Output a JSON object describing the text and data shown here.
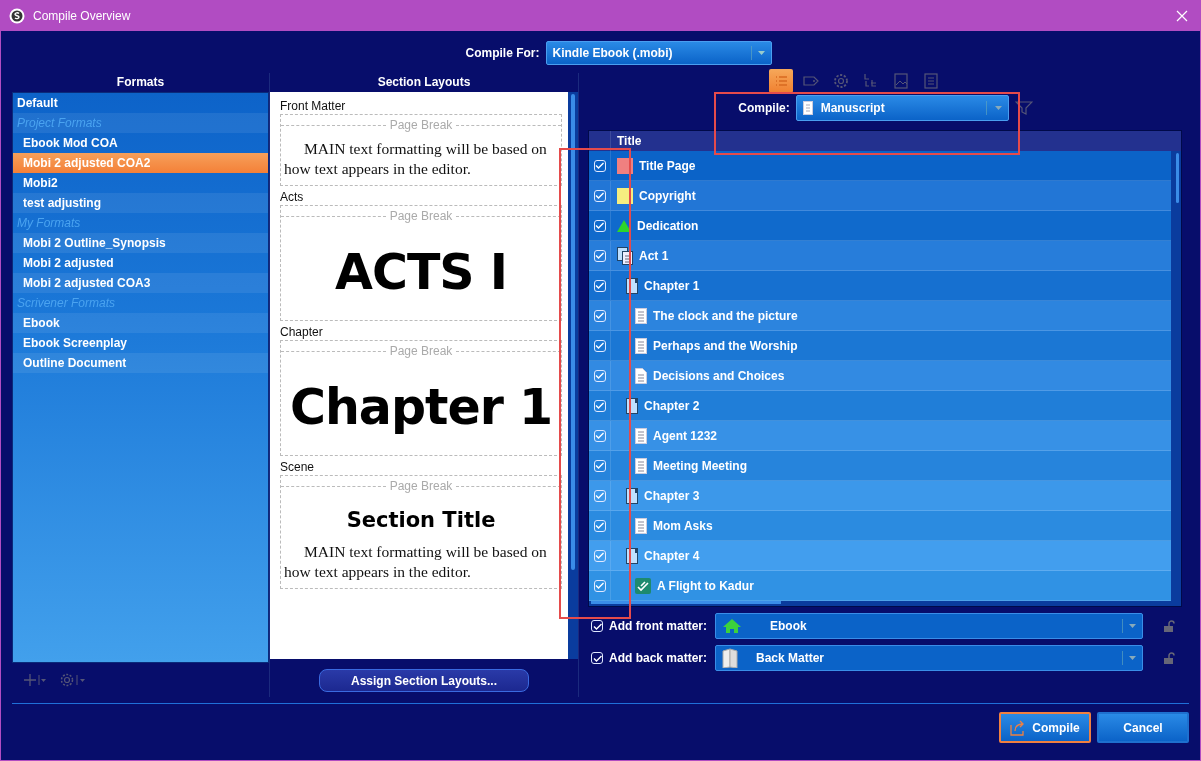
{
  "window": {
    "title": "Compile Overview"
  },
  "compile_for": {
    "label": "Compile For:",
    "value": "Kindle Ebook (.mobi)"
  },
  "formats": {
    "heading": "Formats",
    "items": [
      {
        "kind": "item",
        "label": "Default",
        "selected": false
      },
      {
        "kind": "group",
        "label": "Project Formats"
      },
      {
        "kind": "item",
        "label": "Ebook Mod COA",
        "selected": false
      },
      {
        "kind": "item",
        "label": "Mobi 2 adjusted COA2",
        "selected": true
      },
      {
        "kind": "item",
        "label": "Mobi2",
        "selected": false
      },
      {
        "kind": "item",
        "label": "test adjusting",
        "selected": false
      },
      {
        "kind": "group",
        "label": "My Formats"
      },
      {
        "kind": "item",
        "label": "Mobi 2 Outline_Synopsis",
        "selected": false
      },
      {
        "kind": "item",
        "label": "Mobi 2 adjusted",
        "selected": false
      },
      {
        "kind": "item",
        "label": "Mobi 2 adjusted COA3",
        "selected": false
      },
      {
        "kind": "group",
        "label": "Scrivener Formats"
      },
      {
        "kind": "item",
        "label": "Ebook",
        "selected": false
      },
      {
        "kind": "item",
        "label": "Ebook Screenplay",
        "selected": false
      },
      {
        "kind": "item",
        "label": "Outline Document",
        "selected": false
      }
    ]
  },
  "section_layouts": {
    "heading": "Section Layouts",
    "layouts": [
      {
        "kind": "body",
        "label": "Front Matter",
        "page_break": "Page Break",
        "body": "MAIN text formatting will be based on how text appears in the editor."
      },
      {
        "kind": "heading",
        "label": "Acts",
        "page_break": "Page Break",
        "heading": "ACTS I"
      },
      {
        "kind": "heading",
        "label": "Chapter",
        "page_break": "Page Break",
        "heading": "Chapter 1"
      },
      {
        "kind": "title-body",
        "label": "Scene",
        "page_break": "Page Break",
        "heading": "Section Title",
        "body": "MAIN text formatting will be based on how text appears in the editor."
      }
    ],
    "assign_button": "Assign Section Layouts..."
  },
  "toolbar": [
    {
      "kind": "list",
      "selected": true
    },
    {
      "kind": "tag",
      "selected": false
    },
    {
      "kind": "gear",
      "selected": false
    },
    {
      "kind": "replace",
      "selected": false
    },
    {
      "kind": "image",
      "selected": false
    },
    {
      "kind": "page",
      "selected": false
    }
  ],
  "compile_select": {
    "label": "Compile:",
    "value": "Manuscript",
    "highlighted": true
  },
  "outline": {
    "column": "Title",
    "title_column_highlighted": true,
    "items": [
      {
        "kind": "letter-red",
        "title": "Title Page",
        "checked": true
      },
      {
        "kind": "letter-yellow",
        "title": "Copyright",
        "checked": true
      },
      {
        "kind": "triangle",
        "title": "Dedication",
        "checked": true
      },
      {
        "kind": "stack",
        "title": "Act 1",
        "checked": true,
        "children": [
          {
            "kind": "chapter",
            "title": "Chapter 1",
            "checked": true,
            "children": [
              {
                "kind": "page",
                "title": "The clock and the picture",
                "checked": true
              },
              {
                "kind": "page",
                "title": "Perhaps and the Worship",
                "checked": true
              },
              {
                "kind": "document",
                "title": "Decisions and Choices",
                "checked": true
              }
            ]
          },
          {
            "kind": "chapter",
            "title": "Chapter 2",
            "checked": true,
            "children": [
              {
                "kind": "page",
                "title": "Agent 1232",
                "checked": true
              },
              {
                "kind": "page",
                "title": "Meeting Meeting",
                "checked": true
              }
            ]
          },
          {
            "kind": "chapter",
            "title": "Chapter 3",
            "checked": true,
            "children": [
              {
                "kind": "page",
                "title": "Mom Asks",
                "checked": true
              }
            ]
          },
          {
            "kind": "chapter",
            "title": "Chapter 4",
            "checked": true,
            "children": [
              {
                "kind": "stamp",
                "title": "A Flight to Kadur",
                "checked": true
              }
            ]
          }
        ]
      }
    ]
  },
  "matter": [
    {
      "kind": "front",
      "label": "Add front matter:",
      "checked": true,
      "value": "Ebook"
    },
    {
      "kind": "back",
      "label": "Add back matter:",
      "checked": true,
      "value": "Back Matter"
    }
  ],
  "buttons": [
    {
      "kind": "compile",
      "label": "Compile",
      "focused": true
    },
    {
      "kind": "cancel",
      "label": "Cancel",
      "focused": false
    }
  ]
}
